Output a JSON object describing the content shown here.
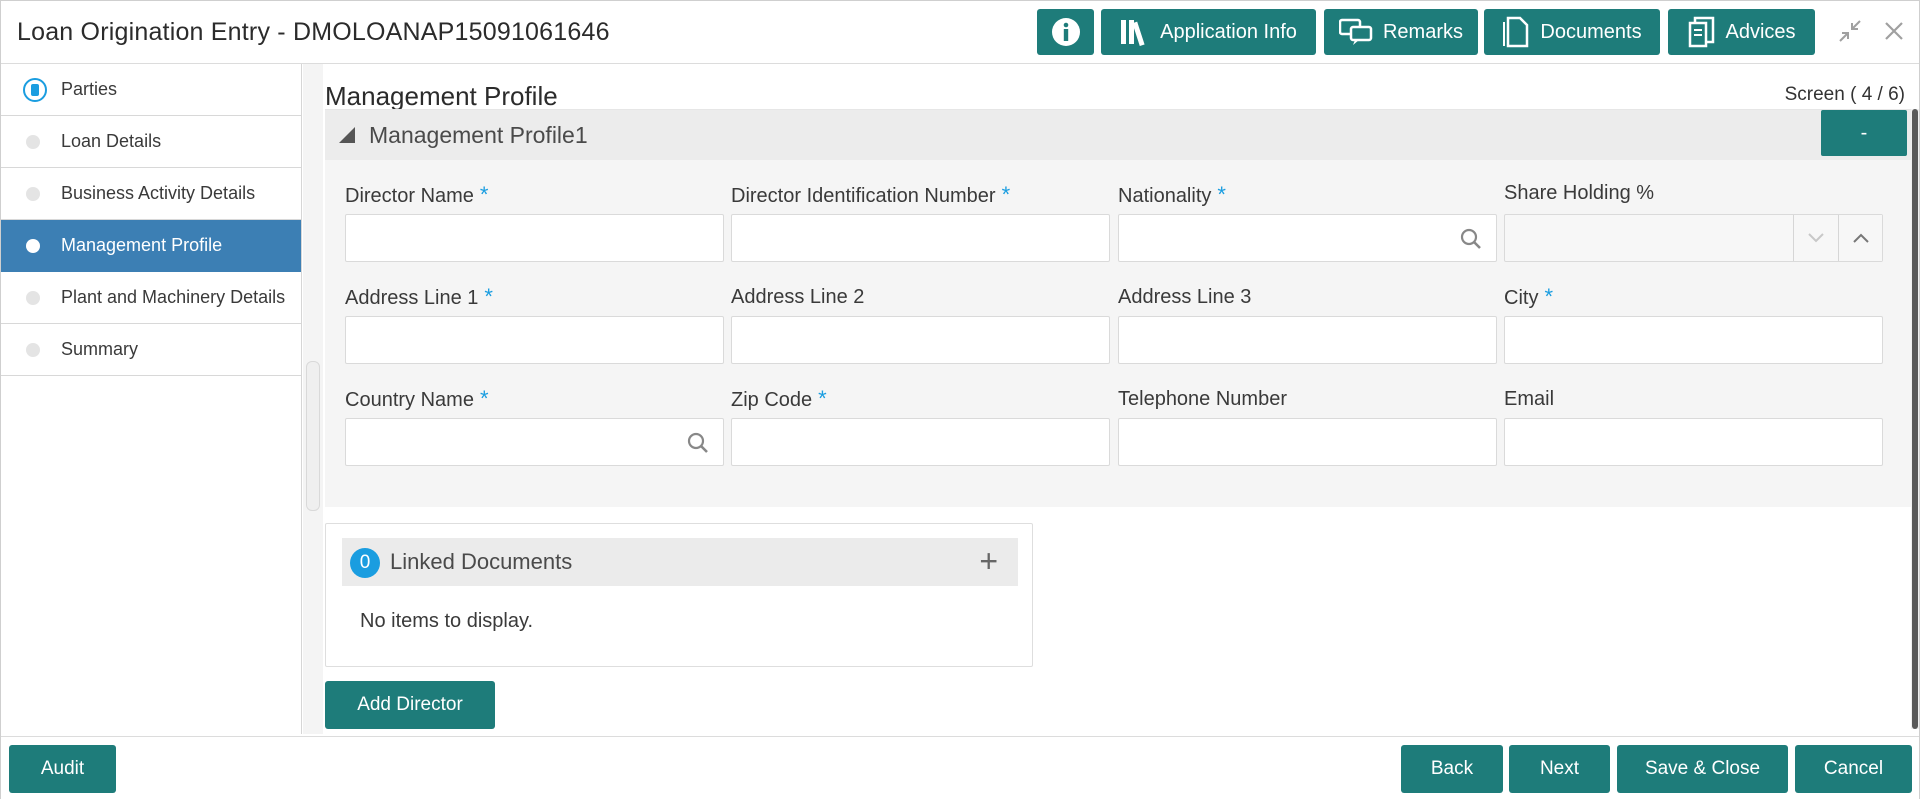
{
  "header": {
    "title": "Loan Origination Entry - DMOLOANAP15091061646",
    "buttons": {
      "info_icon": "info-icon",
      "application_info": "Application Info",
      "remarks": "Remarks",
      "documents": "Documents",
      "advices": "Advices"
    },
    "accent_color": "#1e7c7a"
  },
  "sidebar": {
    "items": [
      {
        "label": "Parties"
      },
      {
        "label": "Loan Details"
      },
      {
        "label": "Business Activity Details"
      },
      {
        "label": "Management Profile"
      },
      {
        "label": "Plant and Machinery Details"
      },
      {
        "label": "Summary"
      }
    ],
    "active_index": 3,
    "active_color": "#3c7fb4"
  },
  "main": {
    "title": "Management Profile",
    "screen": "Screen ( 4 / 6)",
    "section_title": "Management Profile1",
    "collapse_label": "-",
    "fields": {
      "director_name": "Director Name",
      "director_id": "Director Identification Number",
      "nationality": "Nationality",
      "share_holding": "Share Holding %",
      "address1": "Address Line 1",
      "address2": "Address Line 2",
      "address3": "Address Line 3",
      "city": "City",
      "country": "Country Name",
      "zip": "Zip Code",
      "telephone": "Telephone Number",
      "email": "Email"
    },
    "required_mark": "*",
    "linked_documents": {
      "count": "0",
      "title": "Linked Documents",
      "add": "+",
      "empty": "No items to display."
    },
    "add_director": "Add Director"
  },
  "footer": {
    "audit": "Audit",
    "back": "Back",
    "next": "Next",
    "save_close": "Save & Close",
    "cancel": "Cancel"
  }
}
